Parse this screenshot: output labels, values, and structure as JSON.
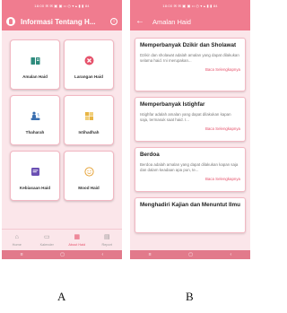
{
  "status_bar_text": "18:00 ✉ ✉ ▣ ▣ ••  ◴ ▾ ▴ ▮ ▮ 84",
  "screen_a": {
    "title": "Informasi Tentang H...",
    "menu": [
      {
        "label": "Amalan Haid",
        "icon": "book-icon",
        "color": "#2e8b7d"
      },
      {
        "label": "Larangan Haid",
        "icon": "cancel-icon",
        "color": "#e6526b"
      },
      {
        "label": "Thaharah",
        "icon": "bath-icon",
        "color": "#3a6fb0"
      },
      {
        "label": "Istihadhah",
        "icon": "puzzle-icon",
        "color": "#e8b545"
      },
      {
        "label": "Kebiasaan Haid",
        "icon": "note-icon",
        "color": "#6a4fb3"
      },
      {
        "label": "Mood Haid",
        "icon": "smile-icon",
        "color": "#e7a53c"
      }
    ],
    "nav": [
      {
        "label": "Home",
        "icon": "home-icon",
        "active": false
      },
      {
        "label": "Kalender",
        "icon": "calendar-icon",
        "active": false
      },
      {
        "label": "About Haid",
        "icon": "calendar-icon",
        "active": true
      },
      {
        "label": "Report",
        "icon": "report-icon",
        "active": false
      }
    ]
  },
  "screen_b": {
    "title": "Amalan Haid",
    "posts": [
      {
        "title": "Memperbanyak Dzikir dan Sholawat",
        "desc": "Dzikir dan sholawat adalah amalan yang dapat dilakukan selama haid. Ini merupakan...",
        "more": "Baca Selengkapnya"
      },
      {
        "title": "Memperbanyak Istighfar",
        "desc": "Istighfar adalah amalan yang dapat dilakukan kapan saja, termasuk saat haid. I...",
        "more": "Baca Selengkapnya"
      },
      {
        "title": "Berdoa",
        "desc": "Berdoa adalah amalan yang dapat dilakukan kapan saja dan dalam keadaan apa pun, te...",
        "more": "Baca Selengkapnya"
      },
      {
        "title": "Menghadiri Kajian dan Menuntut Ilmu",
        "desc": "",
        "more": ""
      }
    ]
  },
  "captions": {
    "a": "A",
    "b": "B"
  }
}
